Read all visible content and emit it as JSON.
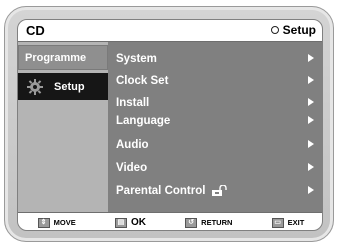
{
  "header": {
    "title": "CD",
    "right_label": "Setup",
    "right_icon": "circle-icon"
  },
  "left_menu": {
    "items": [
      {
        "label": "Programme",
        "icon": ""
      },
      {
        "label": "Setup",
        "icon": "gear-icon"
      }
    ]
  },
  "setup_menu": {
    "items": [
      {
        "label": "System"
      },
      {
        "label": "Clock Set"
      },
      {
        "label": "Install"
      },
      {
        "label": "Language"
      },
      {
        "label": "Audio"
      },
      {
        "label": "Video"
      },
      {
        "label": "Parental Control"
      }
    ]
  },
  "footer": {
    "move": "MOVE",
    "ok": "OK",
    "return": "RETURN",
    "exit": "EXIT"
  },
  "colors": {
    "selected_bg": "#161616",
    "menu_bg": "#808080",
    "left_bg": "#b4b4b4",
    "bar_bg": "#ffffff"
  }
}
